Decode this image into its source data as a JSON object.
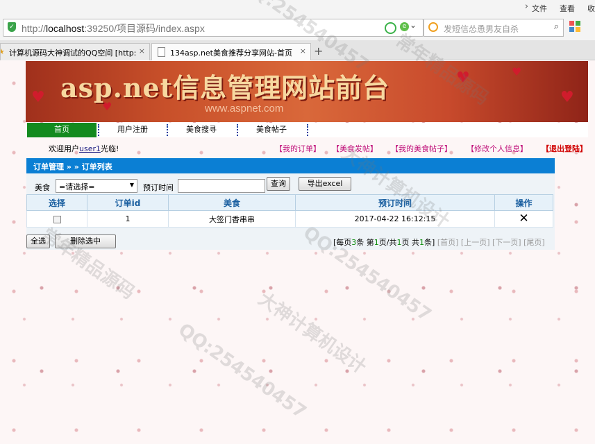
{
  "browser": {
    "menu": [
      "文件",
      "查看",
      "收"
    ],
    "url_prefix": "http://",
    "url_host": "localhost",
    "url_rest": ":39250/项目源码/index.aspx",
    "search_placeholder": "发短信怂恿男友自杀",
    "tabs": [
      {
        "title": "计算机源码大神调试的QQ空间 [http:",
        "close": "×"
      },
      {
        "title": "134asp.net美食推荐分享网站-首页",
        "close": "×"
      }
    ],
    "new_tab": "+"
  },
  "banner": {
    "title": "asp.net信息管理网站前台",
    "subtitle": "www.aspnet.com"
  },
  "nav": [
    "首页",
    "用户注册",
    "美食搜寻",
    "美食帖子"
  ],
  "welcome": {
    "prefix": "欢迎用户",
    "user": "user1",
    "suffix": "光临!"
  },
  "user_menu": [
    "【我的订单】",
    "【美食发帖】",
    "【我的美食帖子】",
    "【修改个人信息】",
    "【退出登陆】"
  ],
  "panel": {
    "heading": "订单管理 » » 订单列表",
    "filter": {
      "food_label": "美食",
      "food_select": "=请选择=",
      "time_label": "预订时间",
      "time_value": "",
      "query_button": "查询",
      "export_button": "导出excel"
    },
    "table": {
      "headers": [
        "选择",
        "订单id",
        "美食",
        "预订时间",
        "操作"
      ],
      "rows": [
        {
          "id": "1",
          "food": "大签门香串串",
          "time": "2017-04-22 16:12:15",
          "action": "✕"
        }
      ]
    },
    "select_all": "全选",
    "delete_selected": "删除选中",
    "pager": {
      "pre1": "[每页",
      "per_page": "3",
      "pre2": "条 第",
      "page": "1",
      "pre3": "页/共",
      "pages": "1",
      "pre4": "页 共",
      "total": "1",
      "pre5": "条]",
      "first": "[首页]",
      "prev": "[上一页]",
      "next": "[下一页]",
      "last": "[尾页]"
    }
  },
  "watermarks": [
    "QQ:254540457",
    "大神计算机设计",
    "常年精品源码",
    "QQ:254540457",
    "大神计算机设计",
    "常年精品源码",
    "QQ:254540457"
  ],
  "colors": {
    "nav_active": "#138a1e",
    "panel_head": "#0b7fd4",
    "user_menu": "#c0107a",
    "logout": "#d00000"
  }
}
